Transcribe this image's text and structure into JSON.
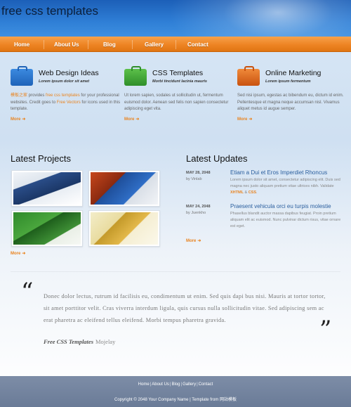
{
  "header": {
    "site_title": "free css templates"
  },
  "nav": {
    "items": [
      {
        "label": "Home"
      },
      {
        "label": "About Us"
      },
      {
        "label": "Blog"
      },
      {
        "label": "Gallery"
      },
      {
        "label": "Contact"
      }
    ]
  },
  "features": [
    {
      "icon": "briefcase-icon",
      "title": "Web Design Ideas",
      "subtitle": "Lorem ipsum dolor sit amet",
      "desc_pre": "",
      "desc_hl1": "模板之家",
      "desc_mid1": " provides ",
      "desc_hl2": "free css templates",
      "desc_mid2": " for your professional websites. Credit goes to ",
      "desc_hl3": "Free Vectors",
      "desc_post": " for icons used in this template.",
      "more": "More"
    },
    {
      "icon": "briefcase-icon",
      "title": "CSS Templates",
      "subtitle": "Morbi tincidunt lacinia mauris",
      "desc": "Ut lorem sapien, sodales ut sollicitudin ut, fermentum euismod dolor. Aenean sed felis non sapien consectetur adipiscing eget vita.",
      "more": "More"
    },
    {
      "icon": "briefcase-icon",
      "title": "Online Marketing",
      "subtitle": "Lorem ipsum fermentum",
      "desc": "Sed nisi ipsum, egestas ac bibendum eu, dictum id enim. Pellentesque et magna neque accumsan nisl. Vivamus aliquet metus id augue semper.",
      "more": "More"
    }
  ],
  "projects": {
    "title": "Latest Projects",
    "more": "More"
  },
  "updates": {
    "title": "Latest Updates",
    "items": [
      {
        "date": "MAY 28, 2048",
        "by": "by Vinlab",
        "title": "Etiam a Dui et Eros Imperdiet Rhoncus",
        "text_pre": "Lorem ipsum dolor sit amet, consectetur adipiscing elit. Duis sed magna nec justo aliquam pretium vitae ultrices nibh. Validate ",
        "hl1": "XHTML",
        "text_mid": " & ",
        "hl2": "CSS",
        "text_post": "."
      },
      {
        "date": "MAY 24, 2048",
        "by": "by Juenkho",
        "title": "Praesent vehicula orci eu turpis molestie",
        "text": "Phasellus blandit auctor massa dapibus feugiat. Proin pretium aliquam elit ac euismod. Nunc pulvinar dictum risus, vitae ornare est eget."
      }
    ],
    "more": "More"
  },
  "quote": {
    "text": "Donec dolor lectus, rutrum id facilisis eu, condimentum ut enim. Sed quis dapi bus nisi. Mauris at tortor tortor, sit amet porttitor velit. Cras viverra interdum ligula, quis cursus nulla sollicitudin vitae. Sed adipiscing sem ac erat pharetra ac eleifend tellus eleifend. Morbi tempus pharetra gravida.",
    "author": "Free CSS Templates",
    "who": "Mojelay"
  },
  "footer": {
    "links": [
      "Home",
      "About Us",
      "Blog",
      "Gallery",
      "Contact"
    ],
    "copyright": "Copyright © 2048 Your Company Name | Template from 网站模板"
  },
  "colors": {
    "accent": "#ee8424",
    "link": "#2b5f9e",
    "header_blue": "#2f7fd6",
    "footer": "#6a7b97"
  }
}
